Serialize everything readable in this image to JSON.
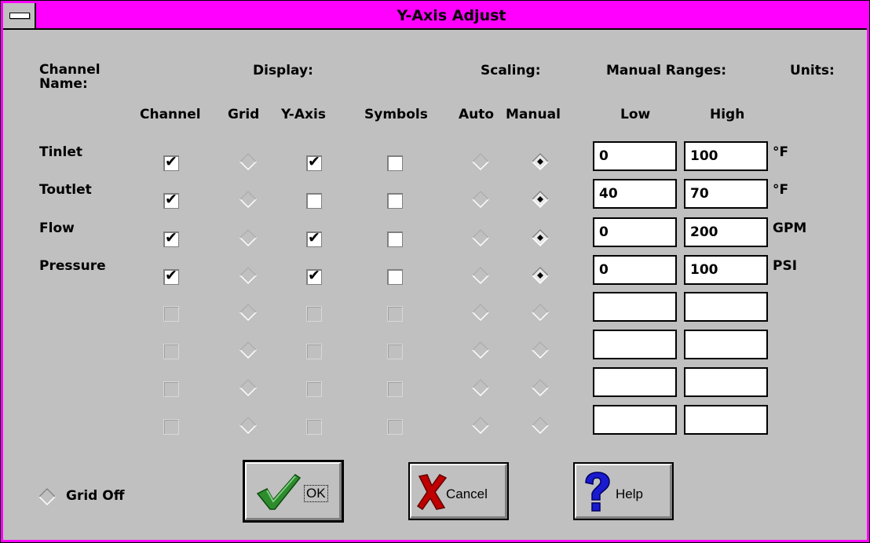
{
  "window": {
    "title": "Y-Axis Adjust"
  },
  "headers": {
    "channel_name": "Channel\nName:",
    "display": "Display:",
    "scaling": "Scaling:",
    "manual_ranges": "Manual Ranges:",
    "units": "Units:",
    "col_channel": "Channel",
    "col_grid": "Grid",
    "col_yaxis": "Y-Axis",
    "col_symbols": "Symbols",
    "col_auto": "Auto",
    "col_manual": "Manual",
    "col_low": "Low",
    "col_high": "High"
  },
  "rows": [
    {
      "name": "Tinlet",
      "channel": true,
      "grid": false,
      "yaxis": true,
      "symbols": false,
      "scaling": "manual",
      "low": "0",
      "high": "100",
      "units": "°F",
      "enabled": true
    },
    {
      "name": "Toutlet",
      "channel": true,
      "grid": false,
      "yaxis": false,
      "symbols": false,
      "scaling": "manual",
      "low": "40",
      "high": "70",
      "units": "°F",
      "enabled": true
    },
    {
      "name": "Flow",
      "channel": true,
      "grid": false,
      "yaxis": true,
      "symbols": false,
      "scaling": "manual",
      "low": "0",
      "high": "200",
      "units": "GPM",
      "enabled": true
    },
    {
      "name": "Pressure",
      "channel": true,
      "grid": false,
      "yaxis": true,
      "symbols": false,
      "scaling": "manual",
      "low": "0",
      "high": "100",
      "units": "PSI",
      "enabled": true
    },
    {
      "name": "",
      "channel": false,
      "grid": false,
      "yaxis": false,
      "symbols": false,
      "scaling": "none",
      "low": "",
      "high": "",
      "units": "",
      "enabled": false
    },
    {
      "name": "",
      "channel": false,
      "grid": false,
      "yaxis": false,
      "symbols": false,
      "scaling": "none",
      "low": "",
      "high": "",
      "units": "",
      "enabled": false
    },
    {
      "name": "",
      "channel": false,
      "grid": false,
      "yaxis": false,
      "symbols": false,
      "scaling": "none",
      "low": "",
      "high": "",
      "units": "",
      "enabled": false
    },
    {
      "name": "",
      "channel": false,
      "grid": false,
      "yaxis": false,
      "symbols": false,
      "scaling": "none",
      "low": "",
      "high": "",
      "units": "",
      "enabled": false
    }
  ],
  "grid_off": {
    "label": "Grid Off",
    "selected": false
  },
  "buttons": {
    "ok": {
      "label": "OK",
      "icon": "checkmark-icon"
    },
    "cancel": {
      "label": "Cancel",
      "icon": "x-cross-icon"
    },
    "help": {
      "label": "Help",
      "icon": "question-mark-icon"
    }
  },
  "colors": {
    "title_bar": "#ff00ff",
    "face": "#c0c0c0",
    "ok_check": "#2e8b2e",
    "cancel_x": "#c00000",
    "help_q": "#0000c0"
  }
}
